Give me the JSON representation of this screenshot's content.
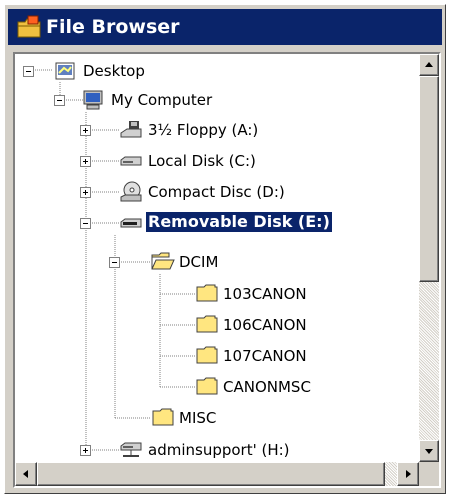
{
  "window": {
    "title": "File Browser",
    "title_icon": "folder-app-icon"
  },
  "tree": {
    "items": [
      {
        "label": "Desktop",
        "icon": "desktop-icon",
        "expanded": true
      },
      {
        "label": "My Computer",
        "icon": "computer-icon",
        "expanded": true
      },
      {
        "label": "3½ Floppy (A:)",
        "icon": "floppy-drive-icon",
        "expanded": false
      },
      {
        "label": "Local Disk (C:)",
        "icon": "hard-disk-icon",
        "expanded": false
      },
      {
        "label": "Compact Disc (D:)",
        "icon": "cd-drive-icon",
        "expanded": false
      },
      {
        "label": "Removable Disk (E:)",
        "icon": "removable-disk-icon",
        "expanded": true,
        "selected": true
      },
      {
        "label": "DCIM",
        "icon": "open-folder-icon",
        "expanded": true
      },
      {
        "label": "103CANON",
        "icon": "folder-icon"
      },
      {
        "label": "106CANON",
        "icon": "folder-icon"
      },
      {
        "label": "107CANON",
        "icon": "folder-icon"
      },
      {
        "label": "CANONMSC",
        "icon": "folder-icon"
      },
      {
        "label": "MISC",
        "icon": "folder-icon"
      },
      {
        "label": "adminsupport' (H:)",
        "icon": "network-drive-icon",
        "expanded": false
      }
    ]
  },
  "colors": {
    "title_bar": "#0a246a",
    "selection": "#0a246a",
    "window_face": "#d4d0c8",
    "folder_yellow": "#ffe680"
  }
}
